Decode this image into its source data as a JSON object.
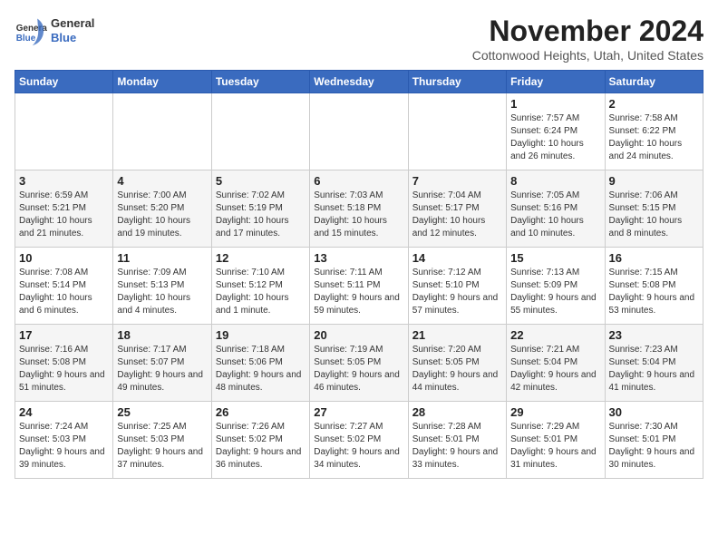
{
  "header": {
    "logo_line1": "General",
    "logo_line2": "Blue",
    "title": "November 2024",
    "subtitle": "Cottonwood Heights, Utah, United States"
  },
  "weekdays": [
    "Sunday",
    "Monday",
    "Tuesday",
    "Wednesday",
    "Thursday",
    "Friday",
    "Saturday"
  ],
  "weeks": [
    [
      {
        "day": "",
        "info": ""
      },
      {
        "day": "",
        "info": ""
      },
      {
        "day": "",
        "info": ""
      },
      {
        "day": "",
        "info": ""
      },
      {
        "day": "",
        "info": ""
      },
      {
        "day": "1",
        "info": "Sunrise: 7:57 AM\nSunset: 6:24 PM\nDaylight: 10 hours and 26 minutes."
      },
      {
        "day": "2",
        "info": "Sunrise: 7:58 AM\nSunset: 6:22 PM\nDaylight: 10 hours and 24 minutes."
      }
    ],
    [
      {
        "day": "3",
        "info": "Sunrise: 6:59 AM\nSunset: 5:21 PM\nDaylight: 10 hours and 21 minutes."
      },
      {
        "day": "4",
        "info": "Sunrise: 7:00 AM\nSunset: 5:20 PM\nDaylight: 10 hours and 19 minutes."
      },
      {
        "day": "5",
        "info": "Sunrise: 7:02 AM\nSunset: 5:19 PM\nDaylight: 10 hours and 17 minutes."
      },
      {
        "day": "6",
        "info": "Sunrise: 7:03 AM\nSunset: 5:18 PM\nDaylight: 10 hours and 15 minutes."
      },
      {
        "day": "7",
        "info": "Sunrise: 7:04 AM\nSunset: 5:17 PM\nDaylight: 10 hours and 12 minutes."
      },
      {
        "day": "8",
        "info": "Sunrise: 7:05 AM\nSunset: 5:16 PM\nDaylight: 10 hours and 10 minutes."
      },
      {
        "day": "9",
        "info": "Sunrise: 7:06 AM\nSunset: 5:15 PM\nDaylight: 10 hours and 8 minutes."
      }
    ],
    [
      {
        "day": "10",
        "info": "Sunrise: 7:08 AM\nSunset: 5:14 PM\nDaylight: 10 hours and 6 minutes."
      },
      {
        "day": "11",
        "info": "Sunrise: 7:09 AM\nSunset: 5:13 PM\nDaylight: 10 hours and 4 minutes."
      },
      {
        "day": "12",
        "info": "Sunrise: 7:10 AM\nSunset: 5:12 PM\nDaylight: 10 hours and 1 minute."
      },
      {
        "day": "13",
        "info": "Sunrise: 7:11 AM\nSunset: 5:11 PM\nDaylight: 9 hours and 59 minutes."
      },
      {
        "day": "14",
        "info": "Sunrise: 7:12 AM\nSunset: 5:10 PM\nDaylight: 9 hours and 57 minutes."
      },
      {
        "day": "15",
        "info": "Sunrise: 7:13 AM\nSunset: 5:09 PM\nDaylight: 9 hours and 55 minutes."
      },
      {
        "day": "16",
        "info": "Sunrise: 7:15 AM\nSunset: 5:08 PM\nDaylight: 9 hours and 53 minutes."
      }
    ],
    [
      {
        "day": "17",
        "info": "Sunrise: 7:16 AM\nSunset: 5:08 PM\nDaylight: 9 hours and 51 minutes."
      },
      {
        "day": "18",
        "info": "Sunrise: 7:17 AM\nSunset: 5:07 PM\nDaylight: 9 hours and 49 minutes."
      },
      {
        "day": "19",
        "info": "Sunrise: 7:18 AM\nSunset: 5:06 PM\nDaylight: 9 hours and 48 minutes."
      },
      {
        "day": "20",
        "info": "Sunrise: 7:19 AM\nSunset: 5:05 PM\nDaylight: 9 hours and 46 minutes."
      },
      {
        "day": "21",
        "info": "Sunrise: 7:20 AM\nSunset: 5:05 PM\nDaylight: 9 hours and 44 minutes."
      },
      {
        "day": "22",
        "info": "Sunrise: 7:21 AM\nSunset: 5:04 PM\nDaylight: 9 hours and 42 minutes."
      },
      {
        "day": "23",
        "info": "Sunrise: 7:23 AM\nSunset: 5:04 PM\nDaylight: 9 hours and 41 minutes."
      }
    ],
    [
      {
        "day": "24",
        "info": "Sunrise: 7:24 AM\nSunset: 5:03 PM\nDaylight: 9 hours and 39 minutes."
      },
      {
        "day": "25",
        "info": "Sunrise: 7:25 AM\nSunset: 5:03 PM\nDaylight: 9 hours and 37 minutes."
      },
      {
        "day": "26",
        "info": "Sunrise: 7:26 AM\nSunset: 5:02 PM\nDaylight: 9 hours and 36 minutes."
      },
      {
        "day": "27",
        "info": "Sunrise: 7:27 AM\nSunset: 5:02 PM\nDaylight: 9 hours and 34 minutes."
      },
      {
        "day": "28",
        "info": "Sunrise: 7:28 AM\nSunset: 5:01 PM\nDaylight: 9 hours and 33 minutes."
      },
      {
        "day": "29",
        "info": "Sunrise: 7:29 AM\nSunset: 5:01 PM\nDaylight: 9 hours and 31 minutes."
      },
      {
        "day": "30",
        "info": "Sunrise: 7:30 AM\nSunset: 5:01 PM\nDaylight: 9 hours and 30 minutes."
      }
    ]
  ]
}
